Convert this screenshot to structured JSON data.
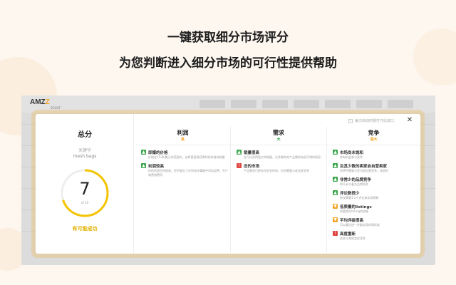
{
  "headline": {
    "line1": "一键获取细分市场评分",
    "line2": "为您判断进入细分市场的可行性提供帮助"
  },
  "app": {
    "logo_main": "AMZ",
    "logo_z": "Z",
    "logo_sub": "SCOUT"
  },
  "modal": {
    "checkbox_label": "每次启动时都打开此窗口",
    "close_icon": "✕",
    "summary": {
      "title": "总分",
      "keyword_label": "关键字",
      "keyword_value": "mesh bags",
      "score": "7",
      "score_of": "of 10",
      "score_fraction": 0.7,
      "verdict": "有可能成功"
    },
    "columns": [
      {
        "title": "利润",
        "level": "高",
        "level_color": "#f5a623",
        "items": [
          {
            "icon": "thumbs-up-icon",
            "type": "good",
            "title": "即爆的价格",
            "desc": "价格在15-80美元的范围内，这将更容易获得利润并维持销量"
          },
          {
            "icon": "thumbs-up-icon",
            "type": "good",
            "title": "利润较高",
            "desc": "你的利润空间很高，您不要忘了在利润计算器中添加运费、生产和营销费用"
          }
        ]
      },
      {
        "title": "需求",
        "level": "大",
        "level_color": "#2a9d3a",
        "items": [
          {
            "icon": "thumbs-up-icon",
            "type": "good",
            "title": "销量很高",
            "desc": "在可以获得强大的销量，大多数你的产品需求有很不错的表现"
          },
          {
            "icon": "shield-icon",
            "type": "bad",
            "title": "旧的市场",
            "desc": "产品需求已经存在很长时间，但也需要与老卖家竞争"
          }
        ]
      },
      {
        "title": "竞争",
        "level": "强大",
        "level_color": "#f5a623",
        "items": [
          {
            "icon": "thumbs-up-icon",
            "type": "good",
            "title": "市场尚未饱和",
            "desc": "你有机会参与竞争"
          },
          {
            "icon": "thumbs-up-icon",
            "type": "good",
            "title": "及其少数的卖家会自营卖家",
            "desc": "你将不需要与亚马逊自营竞争，这很好"
          },
          {
            "icon": "thumbs-up-icon",
            "type": "good",
            "title": "非常少的品牌竞争",
            "desc": "你不必与著名品牌竞争"
          },
          {
            "icon": "thumbs-up-icon",
            "type": "good",
            "title": "评论数很少",
            "desc": "你仅需要1-2个评论来实现销售"
          },
          {
            "icon": "thumbs-down-icon",
            "type": "warn",
            "title": "低质量的listings",
            "desc": "你要提升listing的质量"
          },
          {
            "icon": "thumbs-down-icon",
            "type": "warn",
            "title": "平均评级很高",
            "desc": "可以看出进一步能实现的高标准"
          },
          {
            "icon": "shield-icon",
            "type": "bad",
            "title": "高度重新",
            "desc": "适合与其他卖家竞争"
          }
        ]
      }
    ]
  },
  "colors": {
    "good": "#3aa64a",
    "warn": "#f5a623",
    "bad": "#e0463f",
    "gauge": "#f5c400",
    "gauge_track": "#eeeeee"
  }
}
